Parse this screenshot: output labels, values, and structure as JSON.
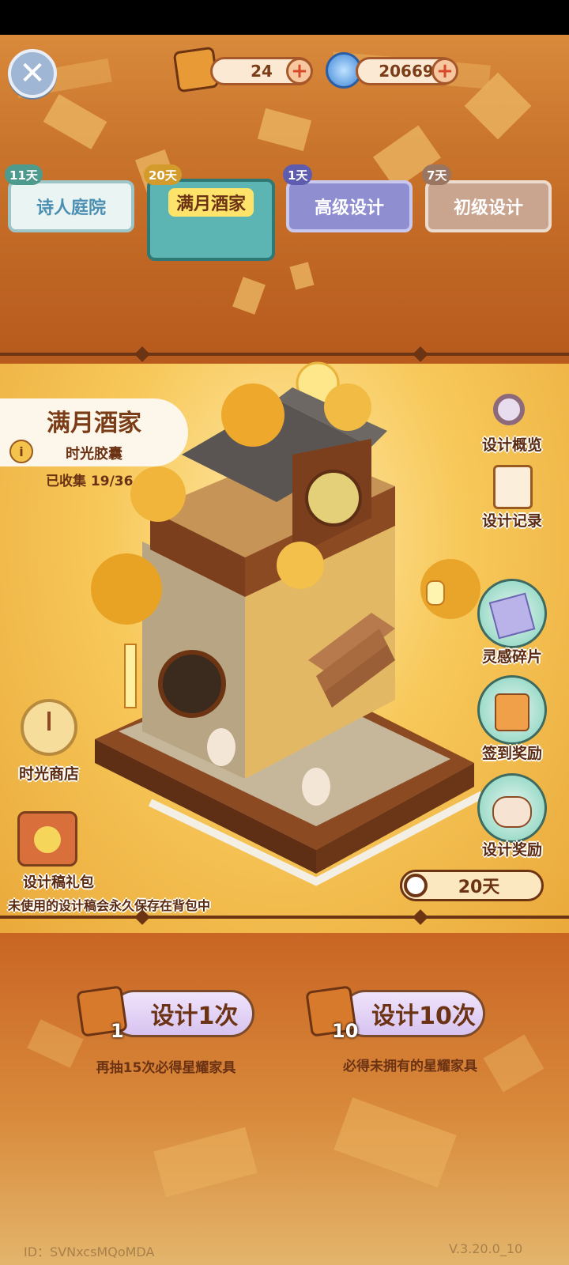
{
  "currency": {
    "scroll_count": "24",
    "gem_count": "20669",
    "plus_symbol": "+"
  },
  "close_symbol": "✕",
  "tabs": [
    {
      "days": "11天",
      "label": "诗人庭院"
    },
    {
      "days": "20天",
      "label": "满月酒家"
    },
    {
      "days": "1天",
      "label": "高级设计"
    },
    {
      "days": "7天",
      "label": "初级设计"
    }
  ],
  "info_card": {
    "title": "满月酒家",
    "subtitle": "时光胶囊",
    "info_symbol": "i",
    "collected": "已收集 19/36"
  },
  "right_menu": {
    "overview": "设计概览",
    "record": "设计记录",
    "fragments": "灵感碎片",
    "checkin": "签到奖励",
    "reward": "设计奖励"
  },
  "left_menu": {
    "shop": "时光商店",
    "pack": "设计稿礼包"
  },
  "notice": "未使用的设计稿会永久保存在背包中",
  "timer": "20天",
  "draw": {
    "once_label": "设计1次",
    "once_count": "1",
    "once_hint": "再抽15次必得星耀家具",
    "ten_label": "设计10次",
    "ten_count": "10",
    "ten_hint": "必得未拥有的星耀家具"
  },
  "footer": {
    "id": "ID：SVNxcsMQoMDA",
    "version": "V.3.20.0_10"
  },
  "colors": {
    "accent_orange": "#b95a1c",
    "gold": "#f7c859",
    "teal_tab": "#5db5b3",
    "purple_tab": "#8f8ed0"
  }
}
